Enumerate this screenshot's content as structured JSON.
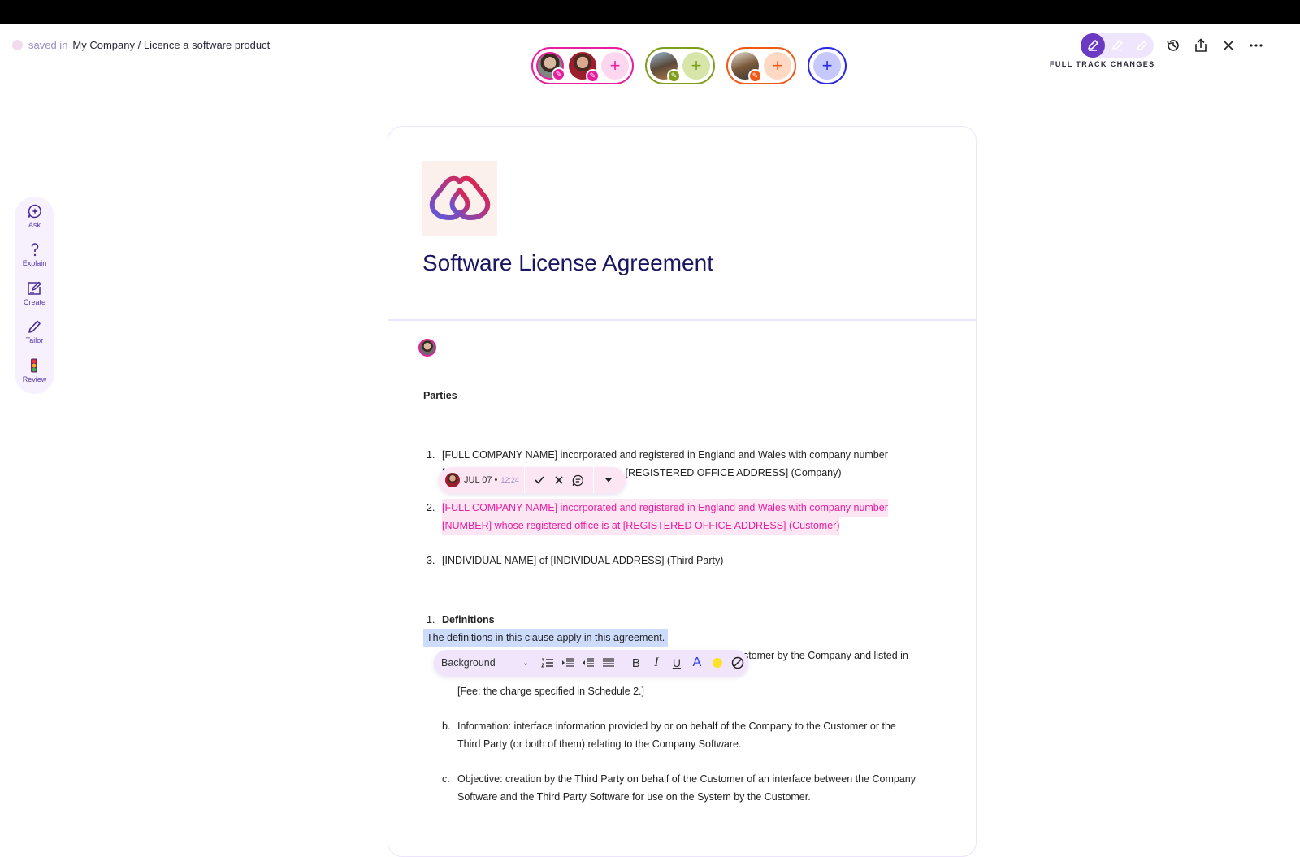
{
  "header": {
    "saved_label": "saved in",
    "path": "My Company / Licence a software product",
    "track_mode_label": "FULL TRACK CHANGES"
  },
  "collaborators": {
    "groups": [
      {
        "color": "#e91e9e",
        "members": 2
      },
      {
        "color": "#7f9e1c",
        "members": 1
      },
      {
        "color": "#f05a16",
        "members": 1
      },
      {
        "color": "#2a2ae0",
        "members": 0
      }
    ],
    "add_glyph": "+"
  },
  "ai_rail": {
    "items": [
      {
        "label": "Ask",
        "icon": "sparkle-chat-icon"
      },
      {
        "label": "Explain",
        "icon": "question-icon"
      },
      {
        "label": "Create",
        "icon": "compose-icon"
      },
      {
        "label": "Tailor",
        "icon": "pencil-icon"
      },
      {
        "label": "Review",
        "icon": "traffic-light-icon"
      }
    ]
  },
  "document": {
    "title": "Software License Agreement",
    "parties_heading": "Parties",
    "parties": [
      {
        "num": "1.",
        "line1": "[FULL COMPANY NAME] incorporated and registered in England and Wales with company number",
        "line2_visible": "[REGISTERED OFFICE ADDRESS] (Company)",
        "line2_start": "["
      },
      {
        "num": "2.",
        "line1": "[FULL COMPANY NAME] incorporated and registered in England and Wales with company number",
        "line2": "[NUMBER] whose registered office is at [REGISTERED OFFICE ADDRESS] (Customer)"
      },
      {
        "num": "3.",
        "line1": "[INDIVIDUAL NAME] of [INDIVIDUAL ADDRESS] (Third Party)"
      }
    ],
    "definitions": {
      "num": "1.",
      "heading": "Definitions",
      "intro": "The definitions in this clause apply in this agreement.",
      "partial_line": "stomer by the Company and listed in",
      "fee": "[Fee: the charge specified in Schedule 2.]",
      "items": [
        {
          "num": "b.",
          "line1": "Information: interface information provided by or on behalf of the Company to the Customer or the",
          "line2": "Third Party (or both of them) relating to the Company Software."
        },
        {
          "num": "c.",
          "line1": "Objective: creation by the Third Party on behalf of the Customer of an interface between the Company",
          "line2": "Software and the Third Party Software for use on the System by the Customer."
        }
      ]
    }
  },
  "track_change_popover": {
    "date": "JUL 07 •",
    "time": "12:24"
  },
  "format_toolbar": {
    "style_value": "Background",
    "bold": "B",
    "italic": "I",
    "underline": "U",
    "text_color": "A",
    "text_color_hex": "#2a3ae0",
    "highlight_hex": "#fde02a"
  }
}
